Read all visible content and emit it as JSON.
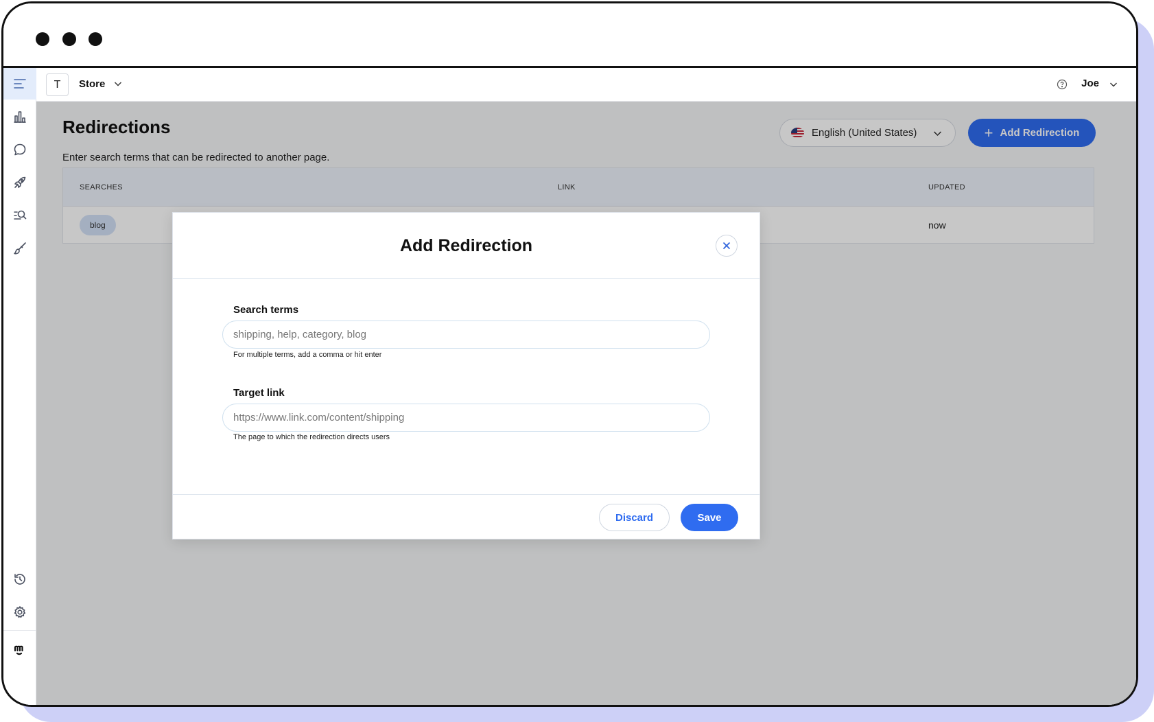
{
  "topbar": {
    "store_initial": "T",
    "store_name": "Store",
    "user_name": "Joe"
  },
  "page": {
    "title": "Redirections",
    "description": "Enter search terms that can be redirected to another page.",
    "language": "English (United States)",
    "add_button": "Add Redirection"
  },
  "table": {
    "headers": {
      "searches": "SEARCHES",
      "link": "LINK",
      "updated": "UPDATED"
    },
    "rows": [
      {
        "search": "blog",
        "link": "",
        "updated": "now"
      }
    ]
  },
  "modal": {
    "title": "Add Redirection",
    "search_label": "Search terms",
    "search_placeholder": "shipping, help, category, blog",
    "search_help": "For multiple terms, add a comma or hit enter",
    "link_label": "Target link",
    "link_placeholder": "https://www.link.com/content/shipping",
    "link_help": "The page to which the redirection directs users",
    "discard": "Discard",
    "save": "Save"
  },
  "sidebar": {
    "items": [
      "menu-icon",
      "analytics-icon",
      "chat-icon",
      "rocket-icon",
      "search-list-icon",
      "brush-icon",
      "history-icon",
      "settings-icon",
      "brand-logo"
    ]
  },
  "colors": {
    "accent": "#2f6cf0",
    "frame_shadow": "#cdd0f7",
    "chip": "#d3e0f7"
  }
}
